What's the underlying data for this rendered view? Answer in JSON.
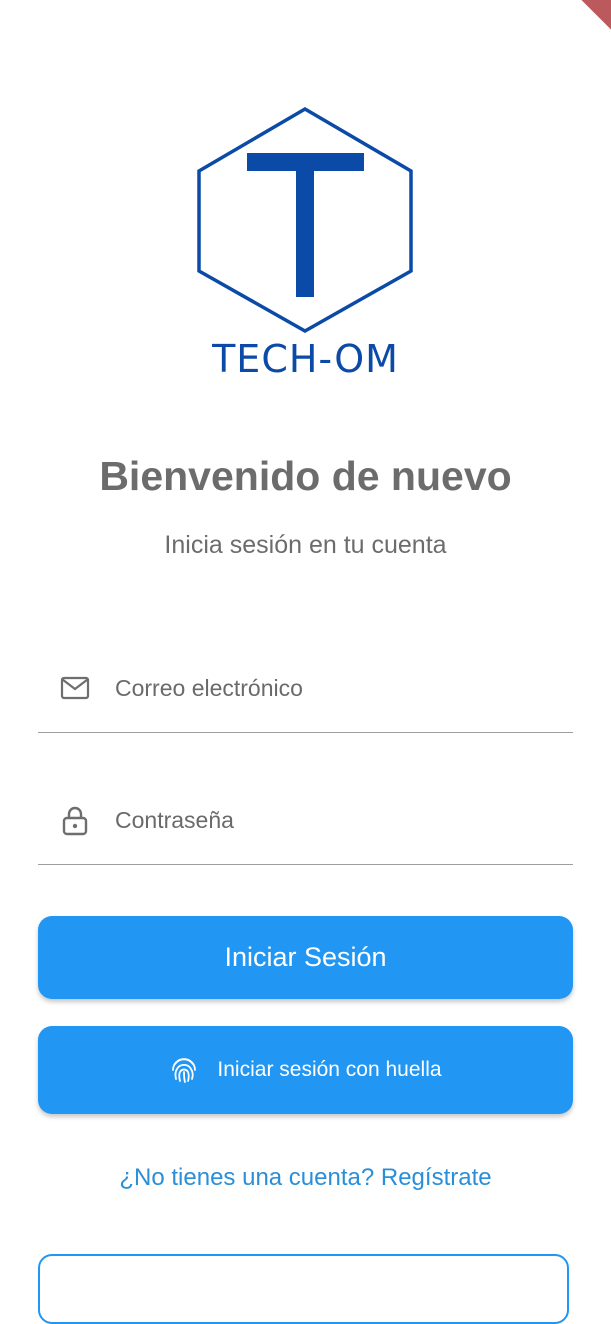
{
  "brand": {
    "name": "TECH-OM",
    "color": "#0b4aa6"
  },
  "header": {
    "title": "Bienvenido de nuevo",
    "subtitle": "Inicia sesión en tu cuenta"
  },
  "form": {
    "email": {
      "placeholder": "Correo electrónico",
      "value": "",
      "icon": "mail-icon"
    },
    "password": {
      "placeholder": "Contraseña",
      "value": "",
      "icon": "lock-icon"
    }
  },
  "buttons": {
    "login_label": "Iniciar Sesión",
    "fingerprint_label": "Iniciar sesión con huella",
    "fingerprint_icon": "fingerprint-icon"
  },
  "links": {
    "register": "¿No tienes una cuenta? Regístrate"
  },
  "colors": {
    "primary": "#2196f3",
    "link": "#2a8fd8",
    "text_gray": "#6c6c6c",
    "debug_ribbon": "#b5474b"
  }
}
